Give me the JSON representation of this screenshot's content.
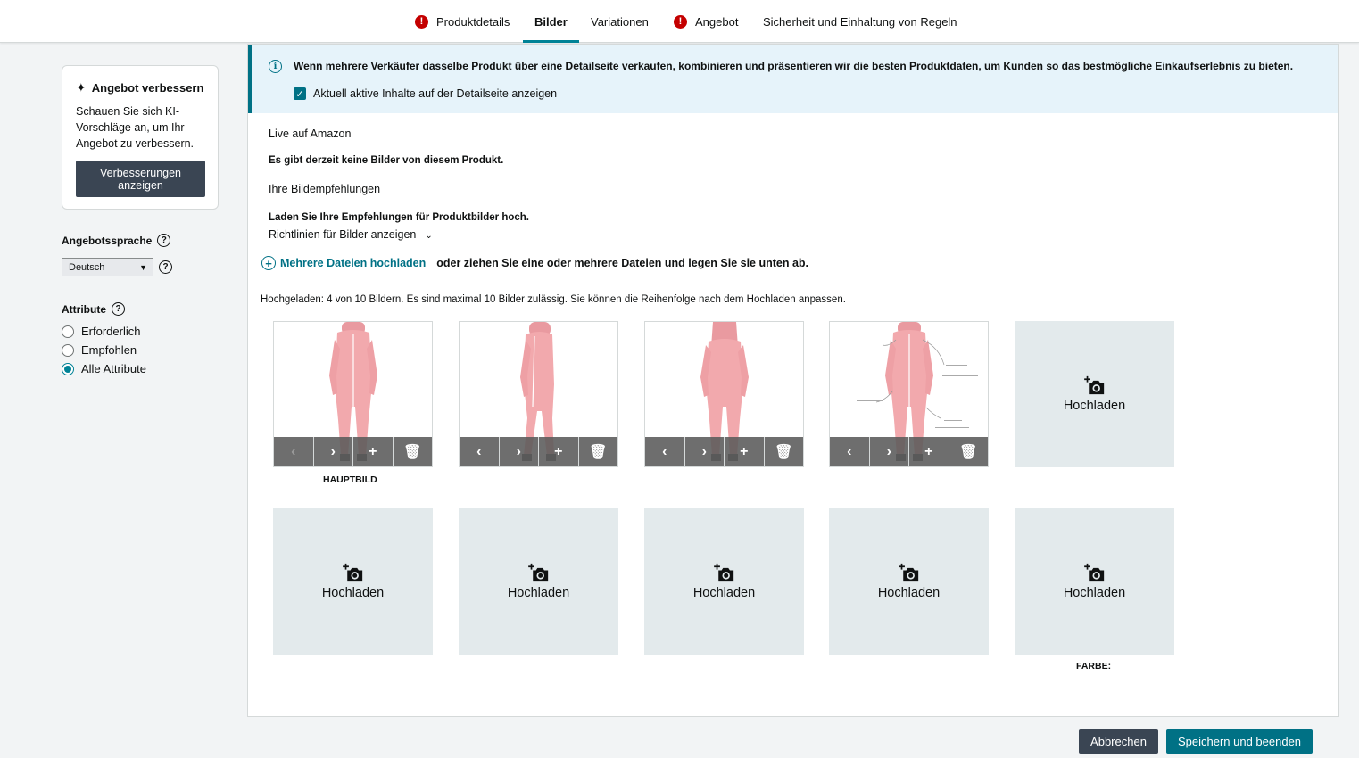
{
  "tabs": [
    {
      "label": "Produktdetails",
      "error": true
    },
    {
      "label": "Bilder",
      "active": true
    },
    {
      "label": "Variationen"
    },
    {
      "label": "Angebot",
      "error": true
    },
    {
      "label": "Sicherheit und Einhaltung von Regeln"
    }
  ],
  "sidebar": {
    "improve_title": "Angebot verbessern",
    "improve_text": "Schauen Sie sich KI-Vorschläge an, um Ihr Angebot zu verbessern.",
    "improve_button": "Verbesserungen anzeigen",
    "language_label": "Angebotssprache",
    "language_value": "Deutsch",
    "attributes_label": "Attribute",
    "attribute_options": [
      "Erforderlich",
      "Empfohlen",
      "Alle Attribute"
    ],
    "attribute_selected": "Alle Attribute"
  },
  "main": {
    "info_text": "Wenn mehrere Verkäufer dasselbe Produkt über eine Detailseite verkaufen, kombinieren und präsentieren wir die besten Produktdaten, um Kunden so das bestmögliche Einkaufserlebnis zu bieten.",
    "show_live_label": "Aktuell aktive Inhalte auf der Detailseite anzeigen",
    "show_live_checked": true,
    "live_heading": "Live auf Amazon",
    "no_images_text": "Es gibt derzeit keine Bilder von diesem Produkt.",
    "recommendations_heading": "Ihre Bildempfehlungen",
    "upload_prompt": "Laden Sie Ihre Empfehlungen für Produktbilder hoch.",
    "guidelines_link": "Richtlinien für Bilder anzeigen",
    "upload_multiple_link": "Mehrere Dateien hochladen",
    "drag_text": "oder ziehen Sie eine oder mehrere Dateien und legen Sie sie unten ab.",
    "upload_status": "Hochgeladen: 4 von 10 Bildern. Es sind maximal 10 Bilder zulässig. Sie können die Reihenfolge nach dem Hochladen anpassen.",
    "main_image_caption": "HAUPTBILD",
    "color_caption": "FARBE:",
    "upload_label": "Hochladen",
    "product_color": "#f2a9ad"
  },
  "footer": {
    "cancel": "Abbrechen",
    "save": "Speichern und beenden"
  }
}
